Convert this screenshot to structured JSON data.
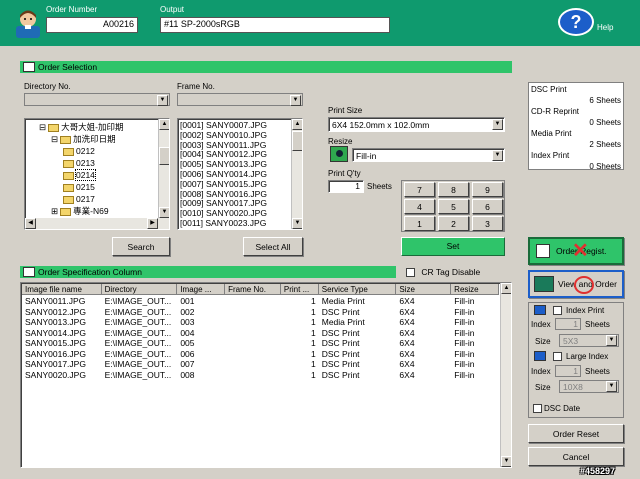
{
  "header": {
    "order_number_label": "Order Number",
    "order_number_value": "A00216",
    "output_label": "Output",
    "output_value": "#11 SP-2000sRGB",
    "help_label": "Help",
    "help_icon_glyph": "?"
  },
  "order_selection": {
    "title": "Order Selection",
    "directory_label": "Directory No.",
    "frame_label": "Frame No.",
    "tree": [
      {
        "indent": 1,
        "expander": "⊟",
        "label": "大哥大姐-加印期"
      },
      {
        "indent": 2,
        "expander": "⊟",
        "label": "加洗印日期"
      },
      {
        "indent": 3,
        "expander": "",
        "label": "0212"
      },
      {
        "indent": 3,
        "expander": "",
        "label": "0213"
      },
      {
        "indent": 3,
        "expander": "",
        "label": "0214"
      },
      {
        "indent": 3,
        "expander": "",
        "label": "0215"
      },
      {
        "indent": 3,
        "expander": "",
        "label": "0217"
      },
      {
        "indent": 2,
        "expander": "⊞",
        "label": "專業-N69"
      }
    ],
    "files": [
      "[0001] SANY0007.JPG",
      "[0002] SANY0010.JPG",
      "[0003] SANY0011.JPG",
      "[0004] SANY0012.JPG",
      "[0005] SANY0013.JPG",
      "[0006] SANY0014.JPG",
      "[0007] SANY0015.JPG",
      "[0008] SANY0016.JPG",
      "[0009] SANY0017.JPG",
      "[0010] SANY0020.JPG",
      "[0011] SANY0023.JPG"
    ],
    "search_button": "Search",
    "select_all_button": "Select All",
    "print_size_label": "Print Size",
    "print_size_value": "6X4  152.0mm x 102.0mm",
    "resize_label": "Resize",
    "resize_value": "Fill-in",
    "print_qty_label": "Print Q'ty",
    "print_qty_value": "1",
    "sheets_label": "Sheets",
    "keypad": [
      "7",
      "8",
      "9",
      "4",
      "5",
      "6",
      "1",
      "2",
      "3"
    ],
    "set_button": "Set"
  },
  "summary": {
    "rows": [
      {
        "name": "DSC Print",
        "value": "6 Sheets"
      },
      {
        "name": "CD-R Reprint",
        "value": "0 Sheets"
      },
      {
        "name": "Media Print",
        "value": "2 Sheets"
      },
      {
        "name": "Index Print",
        "value": "0 Sheets"
      }
    ]
  },
  "spec": {
    "title": "Order Specification Column",
    "cr_tag_label": "CR Tag Disable",
    "columns": [
      "Image file name",
      "Directory",
      "Image ...",
      "Frame No.",
      "Print ...",
      "Service Type",
      "Size",
      "Resize"
    ],
    "rows": [
      [
        "SANY0011.JPG",
        "E:\\IMAGE_OUT...",
        "001",
        "",
        "1",
        "Media Print",
        "6X4",
        "Fill-in"
      ],
      [
        "SANY0012.JPG",
        "E:\\IMAGE_OUT...",
        "002",
        "",
        "1",
        "DSC Print",
        "6X4",
        "Fill-in"
      ],
      [
        "SANY0013.JPG",
        "E:\\IMAGE_OUT...",
        "003",
        "",
        "1",
        "Media Print",
        "6X4",
        "Fill-in"
      ],
      [
        "SANY0014.JPG",
        "E:\\IMAGE_OUT...",
        "004",
        "",
        "1",
        "DSC Print",
        "6X4",
        "Fill-in"
      ],
      [
        "SANY0015.JPG",
        "E:\\IMAGE_OUT...",
        "005",
        "",
        "1",
        "DSC Print",
        "6X4",
        "Fill-in"
      ],
      [
        "SANY0016.JPG",
        "E:\\IMAGE_OUT...",
        "006",
        "",
        "1",
        "DSC Print",
        "6X4",
        "Fill-in"
      ],
      [
        "SANY0017.JPG",
        "E:\\IMAGE_OUT...",
        "007",
        "",
        "1",
        "DSC Print",
        "6X4",
        "Fill-in"
      ],
      [
        "SANY0020.JPG",
        "E:\\IMAGE_OUT...",
        "008",
        "",
        "1",
        "DSC Print",
        "6X4",
        "Fill-in"
      ]
    ]
  },
  "right_panel": {
    "order_regist_button": "Order Regist.",
    "view_and_order_button": "View and Order",
    "index_print_label": "Index Print",
    "index_label": "Index",
    "index_value": "1",
    "sheets_label": "Sheets",
    "size_label": "Size",
    "size_value_1": "5X3",
    "large_index_label": "Large Index",
    "index_value_2": "1",
    "size_value_2": "10X8",
    "dsc_date_label": "DSC Date",
    "order_reset_button": "Order Reset",
    "cancel_button": "Cancel"
  },
  "watermark": "#458297",
  "colors": {
    "header_green": "#0f9a6e",
    "bar_green": "#2fc46a",
    "set_green": "#2fc46a"
  }
}
